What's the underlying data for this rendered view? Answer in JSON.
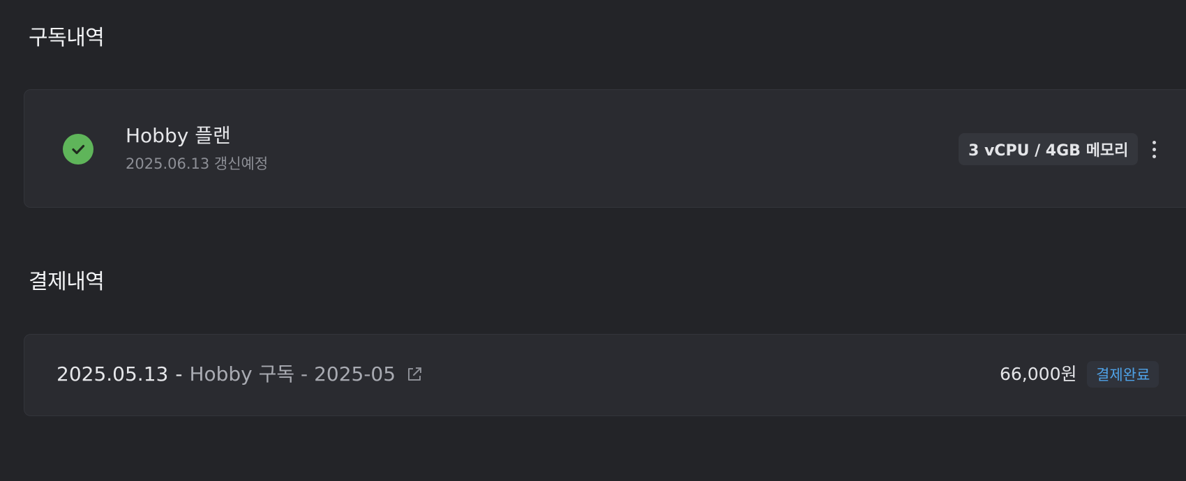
{
  "subscription": {
    "section_title": "구독내역",
    "plan": {
      "name": "Hobby 플랜",
      "renewal": "2025.06.13 갱신예정",
      "spec": "3 vCPU / 4GB 메모리",
      "status_icon": "check-icon",
      "status_color": "#5fb55a"
    },
    "menu_icon": "kebab-menu-icon"
  },
  "payments": {
    "section_title": "결제내역",
    "items": [
      {
        "date": "2025.05.13",
        "separator": "-",
        "description": "Hobby 구독 - 2025-05",
        "link_icon": "external-link-icon",
        "amount": "66,000원",
        "status": "결제완료",
        "status_color": "#4fa3e8"
      }
    ]
  }
}
